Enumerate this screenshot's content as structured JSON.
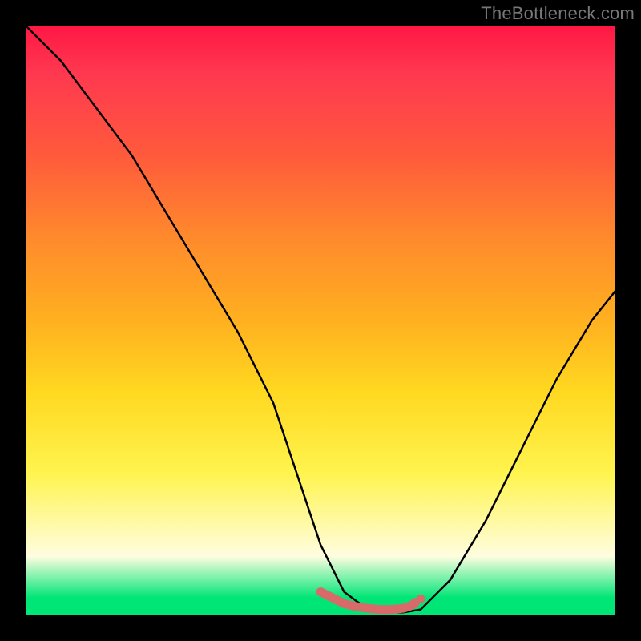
{
  "watermark": "TheBottleneck.com",
  "chart_data": {
    "type": "line",
    "title": "",
    "xlabel": "",
    "ylabel": "",
    "xlim": [
      0,
      100
    ],
    "ylim": [
      0,
      100
    ],
    "grid": false,
    "series": [
      {
        "name": "bottleneck-curve",
        "x": [
          0,
          6,
          12,
          18,
          24,
          30,
          36,
          42,
          46,
          50,
          54,
          58,
          62,
          64,
          67,
          72,
          78,
          84,
          90,
          96,
          100
        ],
        "y": [
          100,
          94,
          86,
          78,
          68,
          58,
          48,
          36,
          24,
          12,
          4,
          1,
          0.5,
          0.5,
          1,
          6,
          16,
          28,
          40,
          50,
          55
        ]
      }
    ],
    "markers": {
      "name": "flat-minimum-dots",
      "color": "#d86a6a",
      "x": [
        50,
        52,
        54,
        56,
        58,
        60,
        62,
        64,
        65,
        66
      ],
      "y": [
        4,
        3,
        2,
        1.5,
        1.2,
        1,
        1,
        1.2,
        1.5,
        2
      ]
    },
    "gradient_stops": [
      {
        "pos": 0,
        "color": "#ff1744"
      },
      {
        "pos": 50,
        "color": "#ffb020"
      },
      {
        "pos": 90,
        "color": "#fffde0"
      },
      {
        "pos": 100,
        "color": "#00e676"
      }
    ]
  }
}
